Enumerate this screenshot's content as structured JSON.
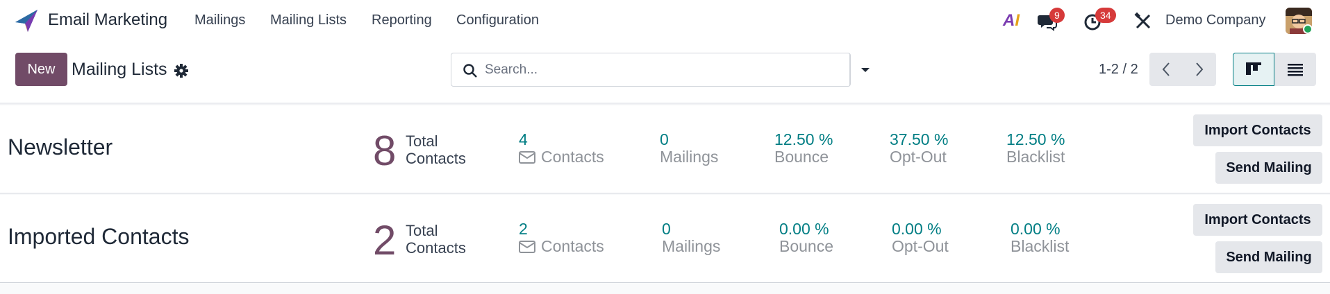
{
  "app": {
    "name": "Email Marketing"
  },
  "menu": [
    "Mailings",
    "Mailing Lists",
    "Reporting",
    "Configuration"
  ],
  "systray": {
    "ai_a": "A",
    "ai_i": "I",
    "messages_count": "9",
    "activities_count": "34",
    "company": "Demo Company"
  },
  "control": {
    "new_label": "New",
    "title": "Mailing Lists",
    "search_placeholder": "Search...",
    "pager": "1-2 / 2"
  },
  "cards": [
    {
      "name": "Newsletter",
      "total": "8",
      "total_label_1": "Total",
      "total_label_2": "Contacts",
      "contacts_value": "4",
      "contacts_label": "Contacts",
      "mailings_value": "0",
      "mailings_label": "Mailings",
      "bounce_value": "12.50 %",
      "bounce_label": "Bounce",
      "optout_value": "37.50 %",
      "optout_label": "Opt-Out",
      "blacklist_value": "12.50 %",
      "blacklist_label": "Blacklist",
      "import_label": "Import Contacts",
      "send_label": "Send Mailing"
    },
    {
      "name": "Imported Contacts",
      "total": "2",
      "total_label_1": "Total",
      "total_label_2": "Contacts",
      "contacts_value": "2",
      "contacts_label": "Contacts",
      "mailings_value": "0",
      "mailings_label": "Mailings",
      "bounce_value": "0.00 %",
      "bounce_label": "Bounce",
      "optout_value": "0.00 %",
      "optout_label": "Opt-Out",
      "blacklist_value": "0.00 %",
      "blacklist_label": "Blacklist",
      "import_label": "Import Contacts",
      "send_label": "Send Mailing"
    }
  ],
  "colors": {
    "brand": "#714b67",
    "accent_teal": "#017e84",
    "badge_red": "#d63a3a"
  },
  "icons": [
    "paper-plane-logo-icon",
    "chat-icon",
    "clock-icon",
    "tools-icon",
    "gear-icon",
    "search-icon",
    "caret-down-icon",
    "chevron-left-icon",
    "chevron-right-icon",
    "kanban-view-icon",
    "list-view-icon",
    "envelope-icon"
  ]
}
